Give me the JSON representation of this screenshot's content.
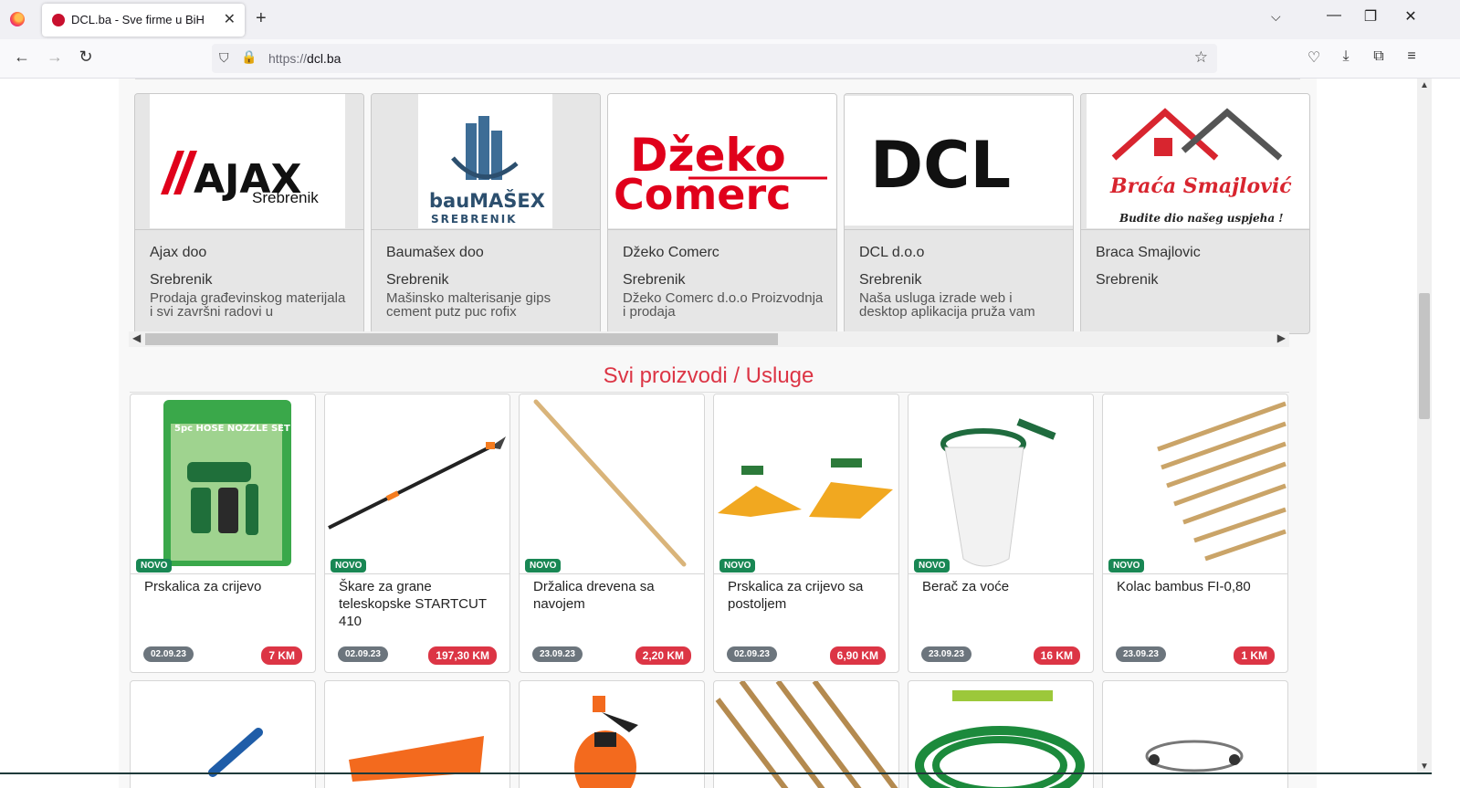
{
  "browser": {
    "tab_title": "DCL.ba - Sve firme u BiH",
    "url_scheme": "https://",
    "url_host": "dcl.ba",
    "icons": {
      "close": "✕",
      "plus": "+",
      "chevron": "⌵",
      "minimize": "—",
      "restore": "❐",
      "win_close": "✕",
      "back": "←",
      "forward": "→",
      "reload": "↻",
      "shield": "⛉",
      "lock": "🔒",
      "star": "☆",
      "pocket": "♡",
      "download": "⤓",
      "extensions": "⧉",
      "menu": "≡"
    }
  },
  "companies": [
    {
      "name": "Ajax doo",
      "city": "Srebrenik",
      "desc": "Prodaja građevinskog materijala i svi završni radovi u",
      "logo_text": "AJAX",
      "logo_sub": "Srebrenik"
    },
    {
      "name": "Baumašex doo",
      "city": "Srebrenik",
      "desc": "Mašinsko malterisanje gips cement putz puc rofix",
      "logo_text": "bauMAŠEX",
      "logo_sub": "SREBRENIK"
    },
    {
      "name": "Džeko Comerc",
      "city": "Srebrenik",
      "desc": "Džeko Comerc d.o.o Proizvodnja i prodaja",
      "logo_text": "Džeko",
      "logo_sub": "Comerc"
    },
    {
      "name": "DCL d.o.o",
      "city": "Srebrenik",
      "desc": "Naša usluga izrade web i desktop aplikacija pruža vam",
      "logo_text": "DCL",
      "logo_sub": ""
    },
    {
      "name": "Braca Smajlovic",
      "city": "Srebrenik",
      "desc": "",
      "logo_text": "Braća Smajlović",
      "logo_sub": "Budite dio našeg uspjeha !"
    }
  ],
  "section_title": "Svi proizvodi / Usluge",
  "badge_new": "NOVO",
  "products": [
    {
      "name": "Prskalica za crijevo",
      "date": "02.09.23",
      "price": "7 KM",
      "img": "hose-nozzle-set",
      "img_label": "5pc HOSE NOZZLE SET"
    },
    {
      "name": "Škare za grane teleskopske STARTCUT 410",
      "date": "02.09.23",
      "price": "197,30 KM",
      "img": "telescopic-pruner"
    },
    {
      "name": "Držalica drevena sa navojem",
      "date": "23.09.23",
      "price": "2,20 KM",
      "img": "wooden-handle"
    },
    {
      "name": "Prskalica za crijevo sa postoljem",
      "date": "02.09.23",
      "price": "6,90 KM",
      "img": "sprinkler"
    },
    {
      "name": "Berač za voće",
      "date": "23.09.23",
      "price": "16 KM",
      "img": "fruit-picker"
    },
    {
      "name": "Kolac bambus FI-0,80",
      "date": "23.09.23",
      "price": "1 KM",
      "img": "bamboo-stakes"
    }
  ],
  "colors": {
    "accent_red": "#dc3545",
    "badge_green": "#198754",
    "date_gray": "#6c757d"
  }
}
